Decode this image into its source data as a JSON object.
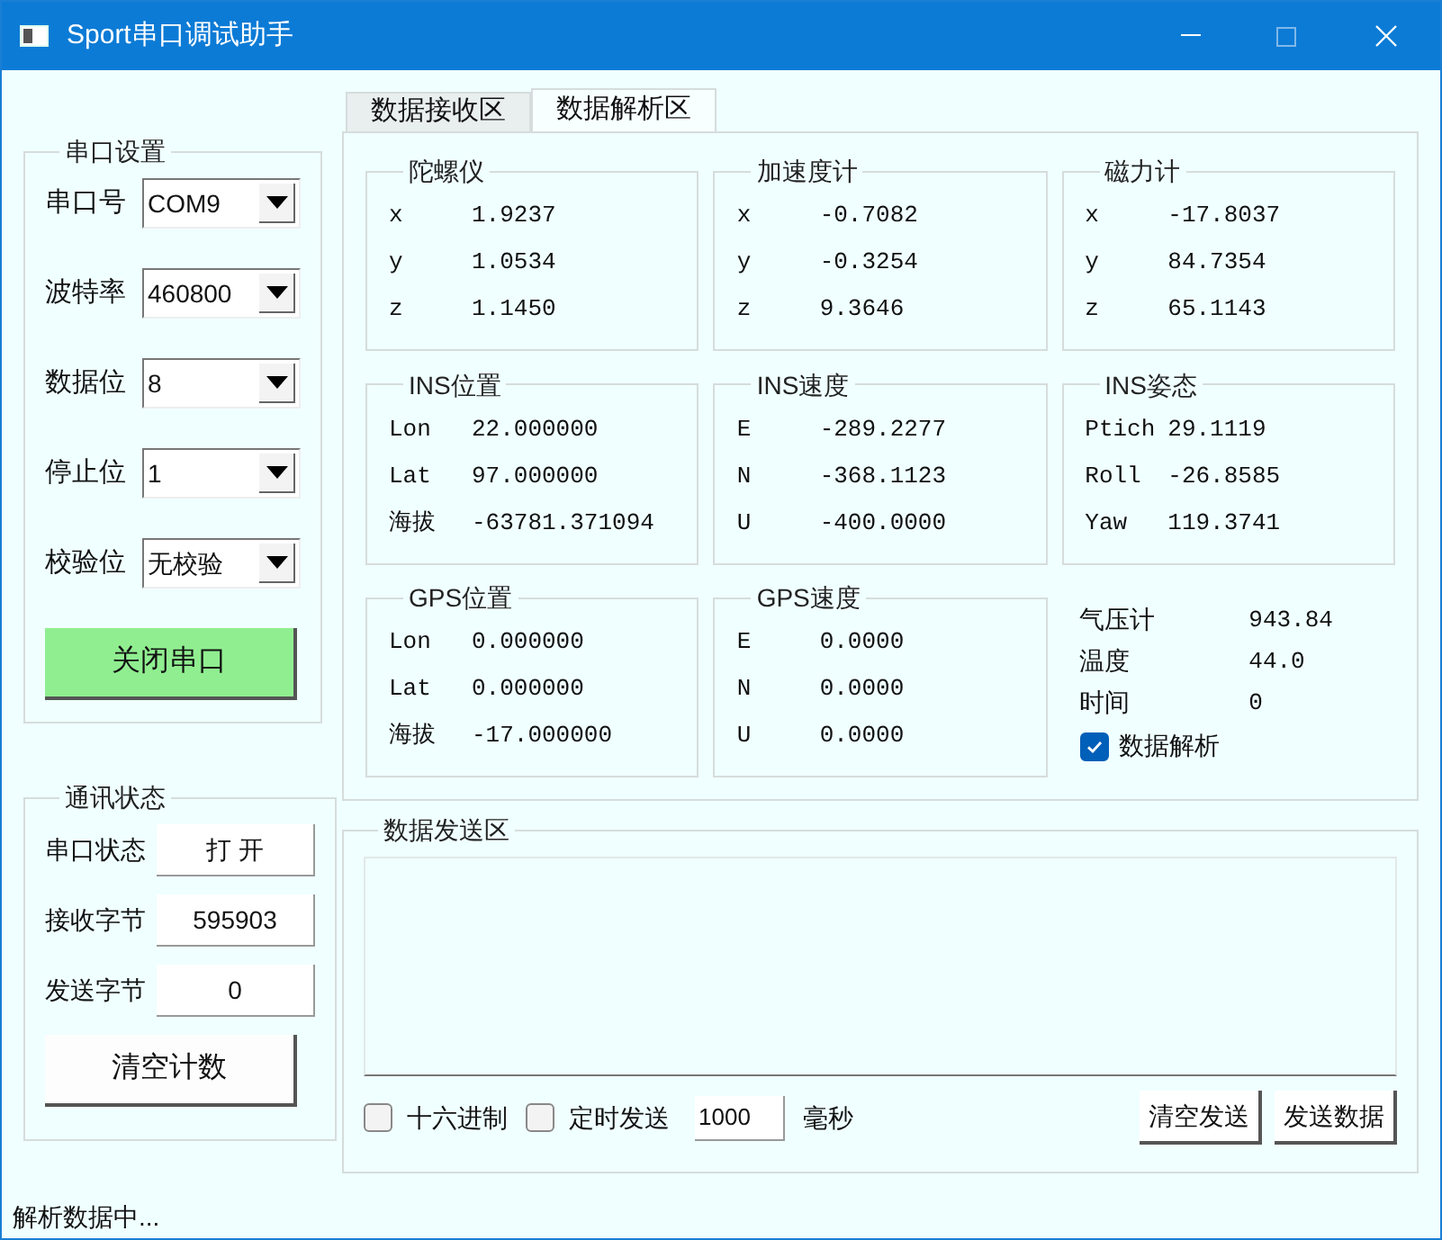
{
  "window": {
    "title": "Sport串口调试助手"
  },
  "serial_settings": {
    "title": "串口设置",
    "fields": [
      {
        "label": "串口号",
        "value": "COM9"
      },
      {
        "label": "波特率",
        "value": "460800"
      },
      {
        "label": "数据位",
        "value": "8"
      },
      {
        "label": "停止位",
        "value": "1"
      },
      {
        "label": "校验位",
        "value": "无校验"
      }
    ],
    "button": "关闭串口"
  },
  "tabs": [
    {
      "label": "数据接收区",
      "selected": false
    },
    {
      "label": "数据解析区",
      "selected": true
    }
  ],
  "sensor_groups": [
    {
      "title": "陀螺仪",
      "rows": [
        {
          "label": "x",
          "value": "1.9237"
        },
        {
          "label": "y",
          "value": "1.0534"
        },
        {
          "label": "z",
          "value": "1.1450"
        }
      ]
    },
    {
      "title": "加速度计",
      "rows": [
        {
          "label": "x",
          "value": "-0.7082"
        },
        {
          "label": "y",
          "value": "-0.3254"
        },
        {
          "label": "z",
          "value": "9.3646"
        }
      ]
    },
    {
      "title": "磁力计",
      "rows": [
        {
          "label": "x",
          "value": "-17.8037"
        },
        {
          "label": "y",
          "value": "84.7354"
        },
        {
          "label": "z",
          "value": "65.1143"
        }
      ]
    },
    {
      "title": "INS位置",
      "rows": [
        {
          "label": "Lon",
          "value": "22.000000"
        },
        {
          "label": "Lat",
          "value": "97.000000"
        },
        {
          "label": "海拔",
          "value": "-63781.371094"
        }
      ]
    },
    {
      "title": "INS速度",
      "rows": [
        {
          "label": "E",
          "value": "-289.2277"
        },
        {
          "label": "N",
          "value": "-368.1123"
        },
        {
          "label": "U",
          "value": "-400.0000"
        }
      ]
    },
    {
      "title": "INS姿态",
      "rows": [
        {
          "label": "Ptich",
          "value": "29.1119"
        },
        {
          "label": "Roll",
          "value": "-26.8585"
        },
        {
          "label": "Yaw",
          "value": "119.3741"
        }
      ]
    },
    {
      "title": "GPS位置",
      "rows": [
        {
          "label": "Lon",
          "value": "0.000000"
        },
        {
          "label": "Lat",
          "value": "0.000000"
        },
        {
          "label": "海拔",
          "value": "-17.000000"
        }
      ]
    },
    {
      "title": "GPS速度",
      "rows": [
        {
          "label": "E",
          "value": "0.0000"
        },
        {
          "label": "N",
          "value": "0.0000"
        },
        {
          "label": "U",
          "value": "0.0000"
        }
      ]
    }
  ],
  "environment": {
    "readings": [
      {
        "label": "气压计",
        "value": "943.84"
      },
      {
        "label": "温度",
        "value": "44.0"
      },
      {
        "label": "时间",
        "value": "0"
      }
    ],
    "checkbox": {
      "label": "数据解析",
      "checked": true
    }
  },
  "comm_status": {
    "title": "通讯状态",
    "rows": [
      {
        "label": "串口状态",
        "value": "打 开"
      },
      {
        "label": "接收字节",
        "value": "595903"
      },
      {
        "label": "发送字节",
        "value": "0"
      }
    ],
    "button": "清空计数"
  },
  "send_area": {
    "title": "数据发送区",
    "options": [
      {
        "label": "十六进制",
        "checked": false
      },
      {
        "label": "定时发送",
        "checked": false
      }
    ],
    "interval": {
      "value": "1000",
      "unit": "毫秒"
    },
    "buttons": [
      "清空发送",
      "发送数据"
    ]
  },
  "status_bar": {
    "text": "解析数据中..."
  }
}
